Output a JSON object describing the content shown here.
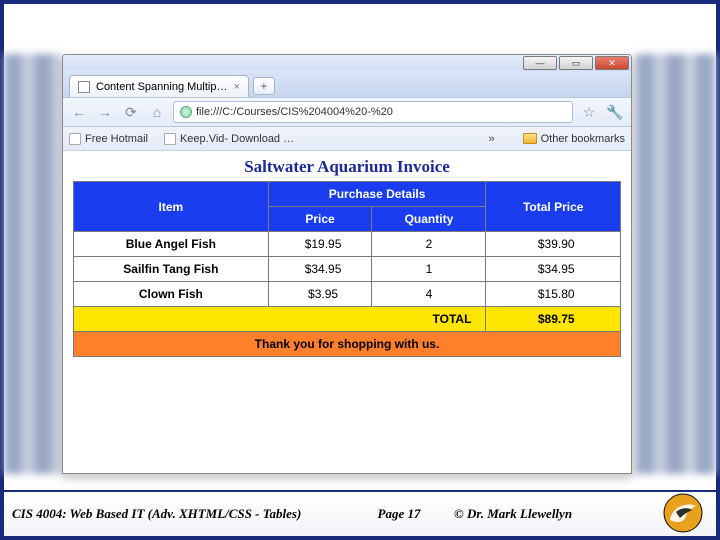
{
  "browser": {
    "tab_title": "Content Spanning Multip…",
    "address": "file:///C:/Courses/CIS%204004%20-%20",
    "bookmarks": {
      "items": [
        "Free Hotmail",
        "Keep.Vid- Download …"
      ],
      "other": "Other bookmarks"
    }
  },
  "page": {
    "title": "Saltwater Aquarium Invoice",
    "headers": {
      "item": "Item",
      "details": "Purchase Details",
      "total": "Total Price",
      "price": "Price",
      "qty": "Quantity"
    },
    "rows": [
      {
        "item": "Blue Angel Fish",
        "price": "$19.95",
        "qty": "2",
        "total": "$39.90"
      },
      {
        "item": "Sailfin Tang Fish",
        "price": "$34.95",
        "qty": "1",
        "total": "$34.95"
      },
      {
        "item": "Clown Fish",
        "price": "$3.95",
        "qty": "4",
        "total": "$15.80"
      }
    ],
    "total_label": "TOTAL",
    "total_value": "$89.75",
    "thanks": "Thank you for shopping with us."
  },
  "slide": {
    "course": "CIS 4004: Web Based IT (Adv. XHTML/CSS - Tables)",
    "page": "Page 17",
    "author": "© Dr. Mark Llewellyn"
  }
}
